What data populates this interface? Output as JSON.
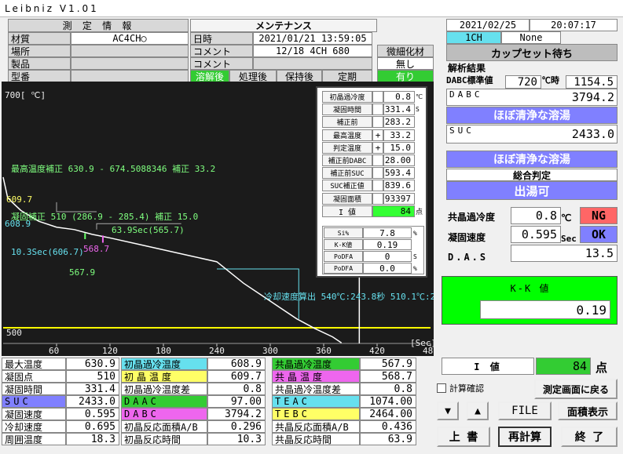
{
  "app": {
    "title": "Leibniz  V1.01"
  },
  "header": {
    "measure_info": "測 定 情 報",
    "maintenance": "メンテナンス",
    "date": "2021/02/25",
    "time": "20:07:17",
    "channel": "1CH",
    "none": "None",
    "status": "カップセット待ち"
  },
  "info": {
    "material_label": "材質",
    "material_value": "AC4CH○",
    "place_label": "場所",
    "place_value": "",
    "product_label": "製品",
    "product_value": "",
    "model_label": "型番",
    "model_value": "",
    "datetime_label": "日時",
    "datetime_value": "2021/01/21 13:59:05",
    "comment1_label": "コメント",
    "comment1_value": "12/18 4CH 680",
    "comment2_label": "コメント",
    "comment2_value": "",
    "refine_label": "微細化材",
    "refine_value": "無し",
    "stage_tabs": [
      "溶解後",
      "処理後",
      "保持後",
      "定期"
    ],
    "modifier_value": "有り"
  },
  "analysis": {
    "title": "解析結果",
    "dabc_std_label": "DABC標準値",
    "dabc_std_value": "720",
    "temp_unit": "℃時",
    "dabc_std_result": "1154.5",
    "dabc_label": "DABC",
    "dabc_value": "3794.2",
    "dabc_judge": "ほぼ清浄な溶湯",
    "suc_label": "SUC",
    "suc_value": "2433.0",
    "suc_judge": "ほぼ清浄な溶湯",
    "overall_label": "総合判定",
    "overall_value": "出湯可",
    "eutectic_label": "共晶過冷度",
    "eutectic_value": "0.8",
    "eutectic_unit": "℃",
    "eutectic_result": "NG",
    "solid_speed_label": "凝固速度",
    "solid_speed_value": "0.595",
    "solid_speed_unit": "Sec",
    "solid_speed_result": "OK",
    "das_label": "D.A.S",
    "das_value": "13.5"
  },
  "kk": {
    "label": "K-K 値",
    "value": "0.19"
  },
  "ivalue": {
    "label": "I 値",
    "value": "84",
    "unit": "点"
  },
  "controls": {
    "calc_check": "計算確認",
    "back_btn": "測定画面に戻る",
    "up_arrow": "▼",
    "down_arrow": "▲",
    "file_btn": "FILE",
    "area_btn": "面積表示",
    "overwrite_btn": "上 書",
    "recalc_btn": "再計算",
    "end_btn": "終 了"
  },
  "overlay": {
    "rows": [
      {
        "label": "初晶過冷度",
        "sign": "",
        "value": "0.8",
        "unit": "℃"
      },
      {
        "label": "凝固時間",
        "sign": "",
        "value": "331.4",
        "unit": "S"
      },
      {
        "label": "補正前",
        "sign": "",
        "value": "283.2",
        "unit": ""
      },
      {
        "label": "最高温度",
        "sign": "+",
        "value": "33.2",
        "unit": ""
      },
      {
        "label": "判定温度",
        "sign": "+",
        "value": "15.0",
        "unit": ""
      },
      {
        "label": "補正前DABC",
        "sign": "",
        "value": "328.00",
        "unit": ""
      },
      {
        "label": "補正前SUC",
        "sign": "",
        "value": "1593.4",
        "unit": ""
      },
      {
        "label": "SUC補正値",
        "sign": "",
        "value": "839.6",
        "unit": ""
      },
      {
        "label": "凝固面積",
        "sign": "",
        "value": "1593397",
        "unit": ""
      }
    ],
    "i_label": "I 値",
    "i_value": "84",
    "i_unit": "点",
    "rows2": [
      {
        "label": "Si%",
        "value": "7.8",
        "unit": "%"
      },
      {
        "label": "K-K値",
        "value": "0.19",
        "unit": ""
      },
      {
        "label": "PoDFA",
        "value": "0",
        "unit": "S"
      },
      {
        "label": "PoDFA",
        "value": "0.0",
        "unit": "%"
      }
    ]
  },
  "chart_data": {
    "type": "line",
    "y_top_label": "700[ ℃]",
    "y_bottom_label": "500",
    "x_ticks": [
      "60",
      "120",
      "180",
      "240",
      "300",
      "360",
      "420",
      "48"
    ],
    "x_unit": "[Sec]",
    "xlim": [
      0,
      480
    ],
    "ylim": [
      500,
      700
    ],
    "x": [
      0,
      5,
      10,
      20,
      40,
      60,
      80,
      100,
      120,
      150,
      180,
      210,
      240,
      270,
      290,
      310,
      330,
      350,
      370,
      380
    ],
    "y": [
      629,
      612,
      608,
      601,
      592,
      587,
      585,
      581,
      578,
      573,
      568,
      563,
      558,
      540,
      530,
      520,
      510,
      502,
      495,
      490
    ],
    "annotations": [
      "最高温度補正  630.9 - 674.5088346 補正 33.2",
      "609.7",
      "凝固補正 510 (286.9 - 285.4) 補正 15.0",
      "608.9",
      "63.9Sec(565.7)",
      "10.3Sec(606.7)",
      "568.7",
      "567.9",
      "冷却速度算出 540℃:243.8秒 510.1℃:2"
    ]
  },
  "bottom": {
    "col1": [
      {
        "l": "最大温度",
        "v": "630.9"
      },
      {
        "l": "凝固点",
        "v": "510"
      },
      {
        "l": "凝固時間",
        "v": "331.4"
      },
      {
        "l": "SUC",
        "v": "2433.0"
      },
      {
        "l": "凝固速度",
        "v": "0.595"
      },
      {
        "l": "冷却速度",
        "v": "0.695"
      },
      {
        "l": "周囲温度",
        "v": "18.3"
      }
    ],
    "col2": [
      {
        "l": "初晶過冷温度",
        "v": "608.9"
      },
      {
        "l": "初晶温度",
        "v": "609.7"
      },
      {
        "l": "初晶過冷温度差",
        "v": "0.8"
      },
      {
        "l": "DAAC",
        "v": "97.00"
      },
      {
        "l": "DABC",
        "v": "3794.2"
      },
      {
        "l": "初晶反応面積A/B",
        "v": "0.296"
      },
      {
        "l": "初晶反応時間",
        "v": "10.3"
      }
    ],
    "col3": [
      {
        "l": "共晶過冷温度",
        "v": "567.9"
      },
      {
        "l": "共晶温度",
        "v": "568.7"
      },
      {
        "l": "共晶過冷温度差",
        "v": "0.8"
      },
      {
        "l": "TEAC",
        "v": "1074.00"
      },
      {
        "l": "TEBC",
        "v": "2464.00"
      },
      {
        "l": "共晶反応面積A/B",
        "v": "0.436"
      },
      {
        "l": "共晶反応時間",
        "v": "63.9"
      }
    ]
  },
  "colors": {
    "cyan": "#66e0ee",
    "green": "#33cc33",
    "lime": "#00ff00",
    "blue_label": "#8080ff",
    "ng": "#ff6666",
    "ok": "#8080ff",
    "magenta": "#ee66ee",
    "yellow": "#ffff66"
  }
}
